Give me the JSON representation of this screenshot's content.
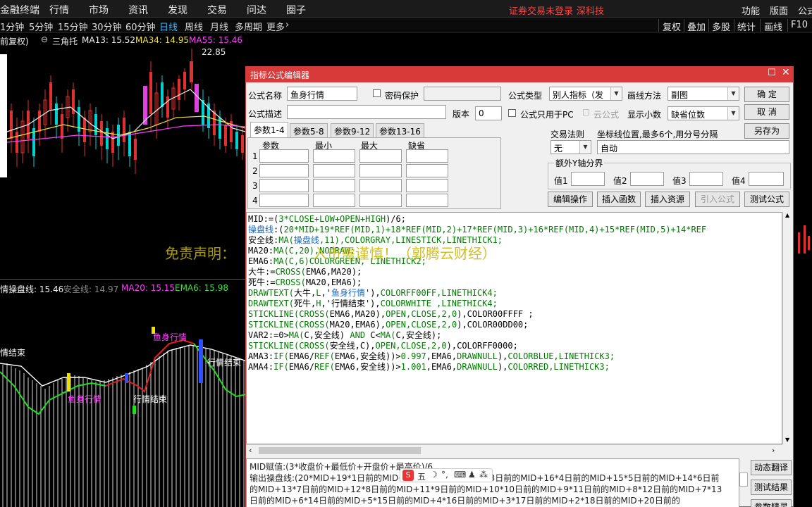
{
  "menubar": {
    "app_name": "金融终端",
    "items": [
      "行情",
      "市场",
      "资讯",
      "发现",
      "交易",
      "问达",
      "圈子"
    ],
    "status_warning": "证券交易未登录",
    "broker": "深科技",
    "right_items": [
      "功能",
      "版面",
      "公式"
    ]
  },
  "periods": {
    "items": [
      "1分钟",
      "5分钟",
      "15分钟",
      "30分钟",
      "60分钟",
      "日线",
      "周线",
      "月线",
      "多周期"
    ],
    "active": "日线",
    "more": "更多"
  },
  "toolbar_right": [
    "复权",
    "叠加",
    "多股",
    "统计",
    "画线",
    "F10"
  ],
  "main_chart": {
    "header_prefix": "前复权)",
    "indicator": "三角托",
    "ma13": "MA13: 15.52",
    "ma34": "MA34: 14.95",
    "ma55": "MA55: 15.46",
    "price_high": "22.85"
  },
  "indicator_chart": {
    "header_prefix": "情",
    "l1": "操盘线: 15.46",
    "l2": "安全线: 14.97",
    "l3": "MA20: 15.15",
    "l4": "EMA6: 15.98",
    "labels": {
      "end1": "情结束",
      "yu1": "鱼身行情",
      "yu2": "鱼身行情",
      "end2": "行情结束",
      "end3": "行情结束"
    }
  },
  "watermark": "免责声明：　　　　　　入市需谨慎！（郭腾云财经）",
  "dialog": {
    "title": "指标公式编辑器",
    "formula_name_label": "公式名称",
    "formula_name_value": "鱼身行情",
    "password_label": "密码保护",
    "formula_type_label": "公式类型",
    "formula_type_value": "别人指标（发",
    "draw_method_label": "画线方法",
    "draw_method_value": "副图",
    "ok": "确 定",
    "cancel": "取 消",
    "saveas": "另存为",
    "desc_label": "公式描述",
    "version_label": "版本",
    "version_value": "0",
    "pc_only_label": "公式只用于PC",
    "cloud_label": "云公式",
    "decimals_label": "显示小数",
    "decimals_value": "缺省位数",
    "tabs": [
      "参数1-4",
      "参数5-8",
      "参数9-12",
      "参数13-16"
    ],
    "param_headers": [
      "参数",
      "最小",
      "最大",
      "缺省"
    ],
    "param_rows": [
      "1",
      "2",
      "3",
      "4"
    ],
    "trade_rule_label": "交易法则",
    "trade_rule_value": "无",
    "coord_label": "坐标线位置,最多6个,用分号分隔",
    "coord_value": "自动",
    "extra_y_label": "额外Y轴分界",
    "val_labels": [
      "值1",
      "值2",
      "值3",
      "值4"
    ],
    "buttons": [
      "编辑操作",
      "插入函数",
      "插入资源",
      "引入公式",
      "测试公式"
    ],
    "bottom_lines": [
      "MID赋值:(3*收盘价+最低价+开盘价+最高价)/6",
      "输出操盘线:(20*MID+19*1日前的MID+18*2日前的MID+17*3日前的MID+16*4日前的MID+15*5日前的MID+14*6日前",
      "的MID+13*7日前的MID+12*8日前的MID+11*9日前的MID+10*10日前的MID+9*11日前的MID+8*12日前的MID+7*13",
      "日前的MID+6*14日前的MID+5*15日前的MID+4*16日前的MID+3*17日前的MID+2*18日前的MID+20日前的"
    ],
    "side_buttons": [
      "动态翻译",
      "测试结果",
      "参数精灵"
    ],
    "ime": "五"
  }
}
